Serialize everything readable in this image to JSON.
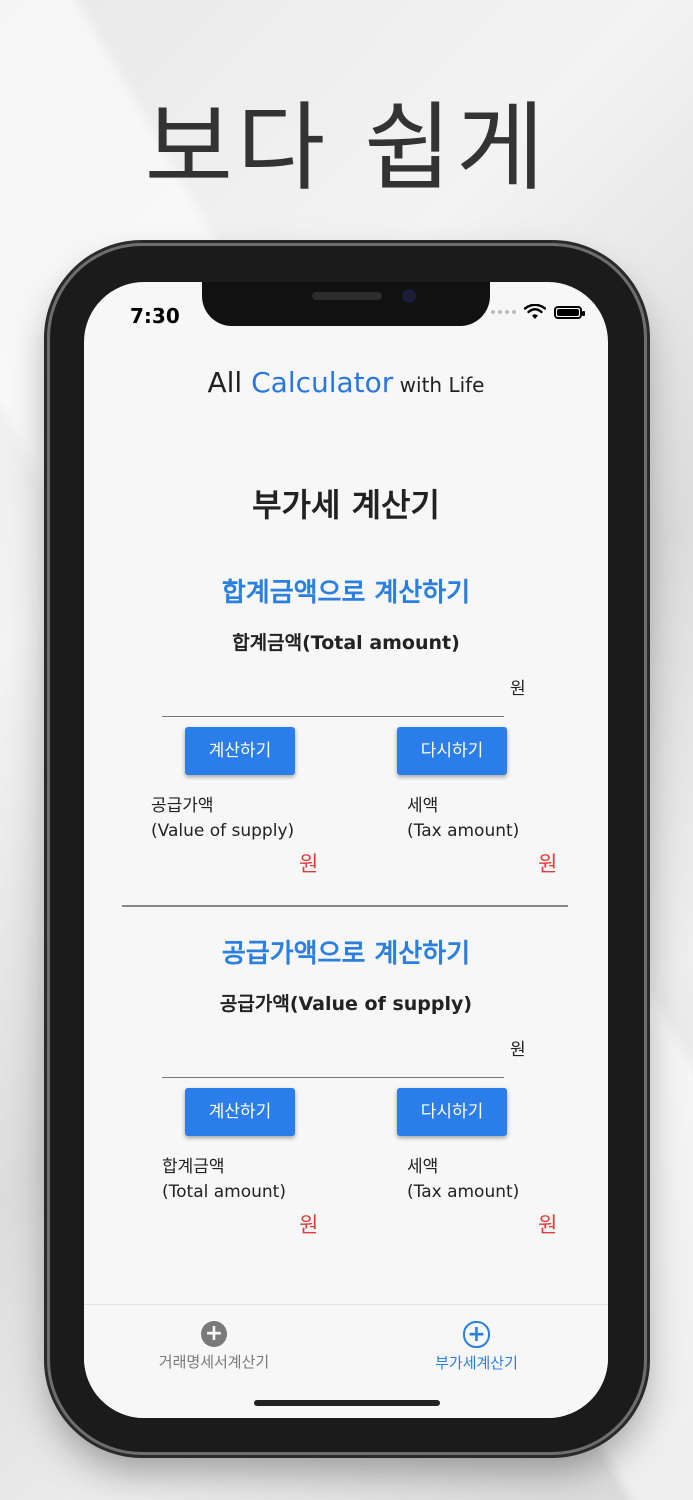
{
  "headline": "보다 쉽게",
  "status": {
    "time": "7:30"
  },
  "app_title": {
    "part1": "All ",
    "accent": "Calculator",
    "part2": " with Life"
  },
  "page_title": "부가세 계산기",
  "section1": {
    "title": "합계금액으로 계산하기",
    "field_label": "합계금액(Total amount)",
    "input_value": "",
    "unit": "원",
    "calc_button": "계산하기",
    "reset_button": "다시하기",
    "result1_label_ko": "공급가액",
    "result1_label_en": "(Value of supply)",
    "result1_unit": "원",
    "result2_label_ko": "세액",
    "result2_label_en": "(Tax amount)",
    "result2_unit": "원"
  },
  "section2": {
    "title": "공급가액으로 계산하기",
    "field_label": "공급가액(Value of supply)",
    "input_value": "",
    "unit": "원",
    "calc_button": "계산하기",
    "reset_button": "다시하기",
    "result1_label_ko": "합계금액",
    "result1_label_en": "(Total amount)",
    "result1_unit": "원",
    "result2_label_ko": "세액",
    "result2_label_en": "(Tax amount)",
    "result2_unit": "원"
  },
  "tabs": [
    {
      "label": "거래명세서계산기",
      "icon": "add-circle-filled-icon",
      "active": false,
      "color": "#7a7a7a"
    },
    {
      "label": "부가세계산기",
      "icon": "add-circle-outline-icon",
      "active": true,
      "color": "#2b7fe0"
    }
  ],
  "colors": {
    "accent": "#2b7fe0",
    "button": "#2b7de9",
    "result_unit": "#e23b3b"
  }
}
